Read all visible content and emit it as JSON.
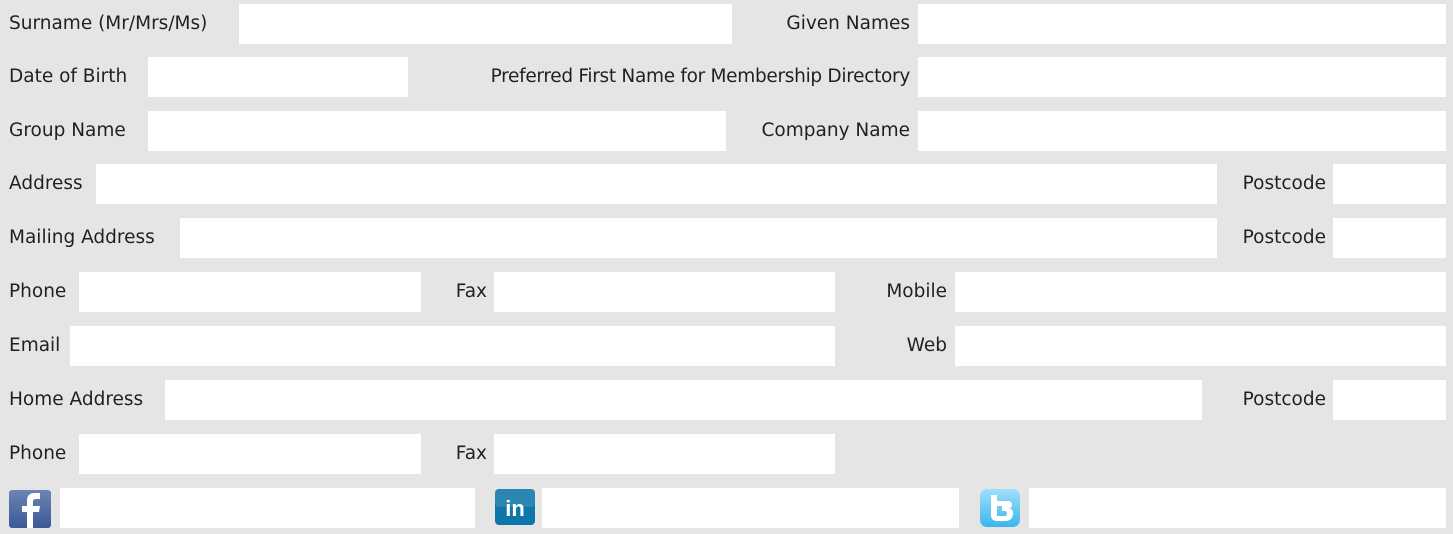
{
  "form": {
    "surname": {
      "label": "Surname (Mr/Mrs/Ms)",
      "value": ""
    },
    "given_names": {
      "label": "Given Names",
      "value": ""
    },
    "date_of_birth": {
      "label": "Date of Birth",
      "value": ""
    },
    "preferred_name": {
      "label": "Preferred First Name for Membership Directory",
      "value": ""
    },
    "group_name": {
      "label": "Group Name",
      "value": ""
    },
    "company_name": {
      "label": "Company Name",
      "value": ""
    },
    "address": {
      "label": "Address",
      "value": ""
    },
    "address_postcode": {
      "label": "Postcode",
      "value": ""
    },
    "mailing_address": {
      "label": "Mailing Address",
      "value": ""
    },
    "mailing_postcode": {
      "label": "Postcode",
      "value": ""
    },
    "phone": {
      "label": "Phone",
      "value": ""
    },
    "fax": {
      "label": "Fax",
      "value": ""
    },
    "mobile": {
      "label": "Mobile",
      "value": ""
    },
    "email": {
      "label": "Email",
      "value": ""
    },
    "web": {
      "label": "Web",
      "value": ""
    },
    "home_address": {
      "label": "Home Address",
      "value": ""
    },
    "home_postcode": {
      "label": "Postcode",
      "value": ""
    },
    "home_phone": {
      "label": "Phone",
      "value": ""
    },
    "home_fax": {
      "label": "Fax",
      "value": ""
    }
  },
  "social": {
    "facebook": {
      "icon": "facebook-icon",
      "value": ""
    },
    "linkedin": {
      "icon": "linkedin-icon",
      "value": "",
      "icon_text": "in"
    },
    "twitter": {
      "icon": "twitter-icon",
      "value": ""
    }
  },
  "colors": {
    "background": "#e5e5e6",
    "field": "#ffffff",
    "text": "#231f20",
    "facebook": "#3b5998",
    "linkedin": "#0e76a8",
    "twitter": "#5fc9f8"
  }
}
